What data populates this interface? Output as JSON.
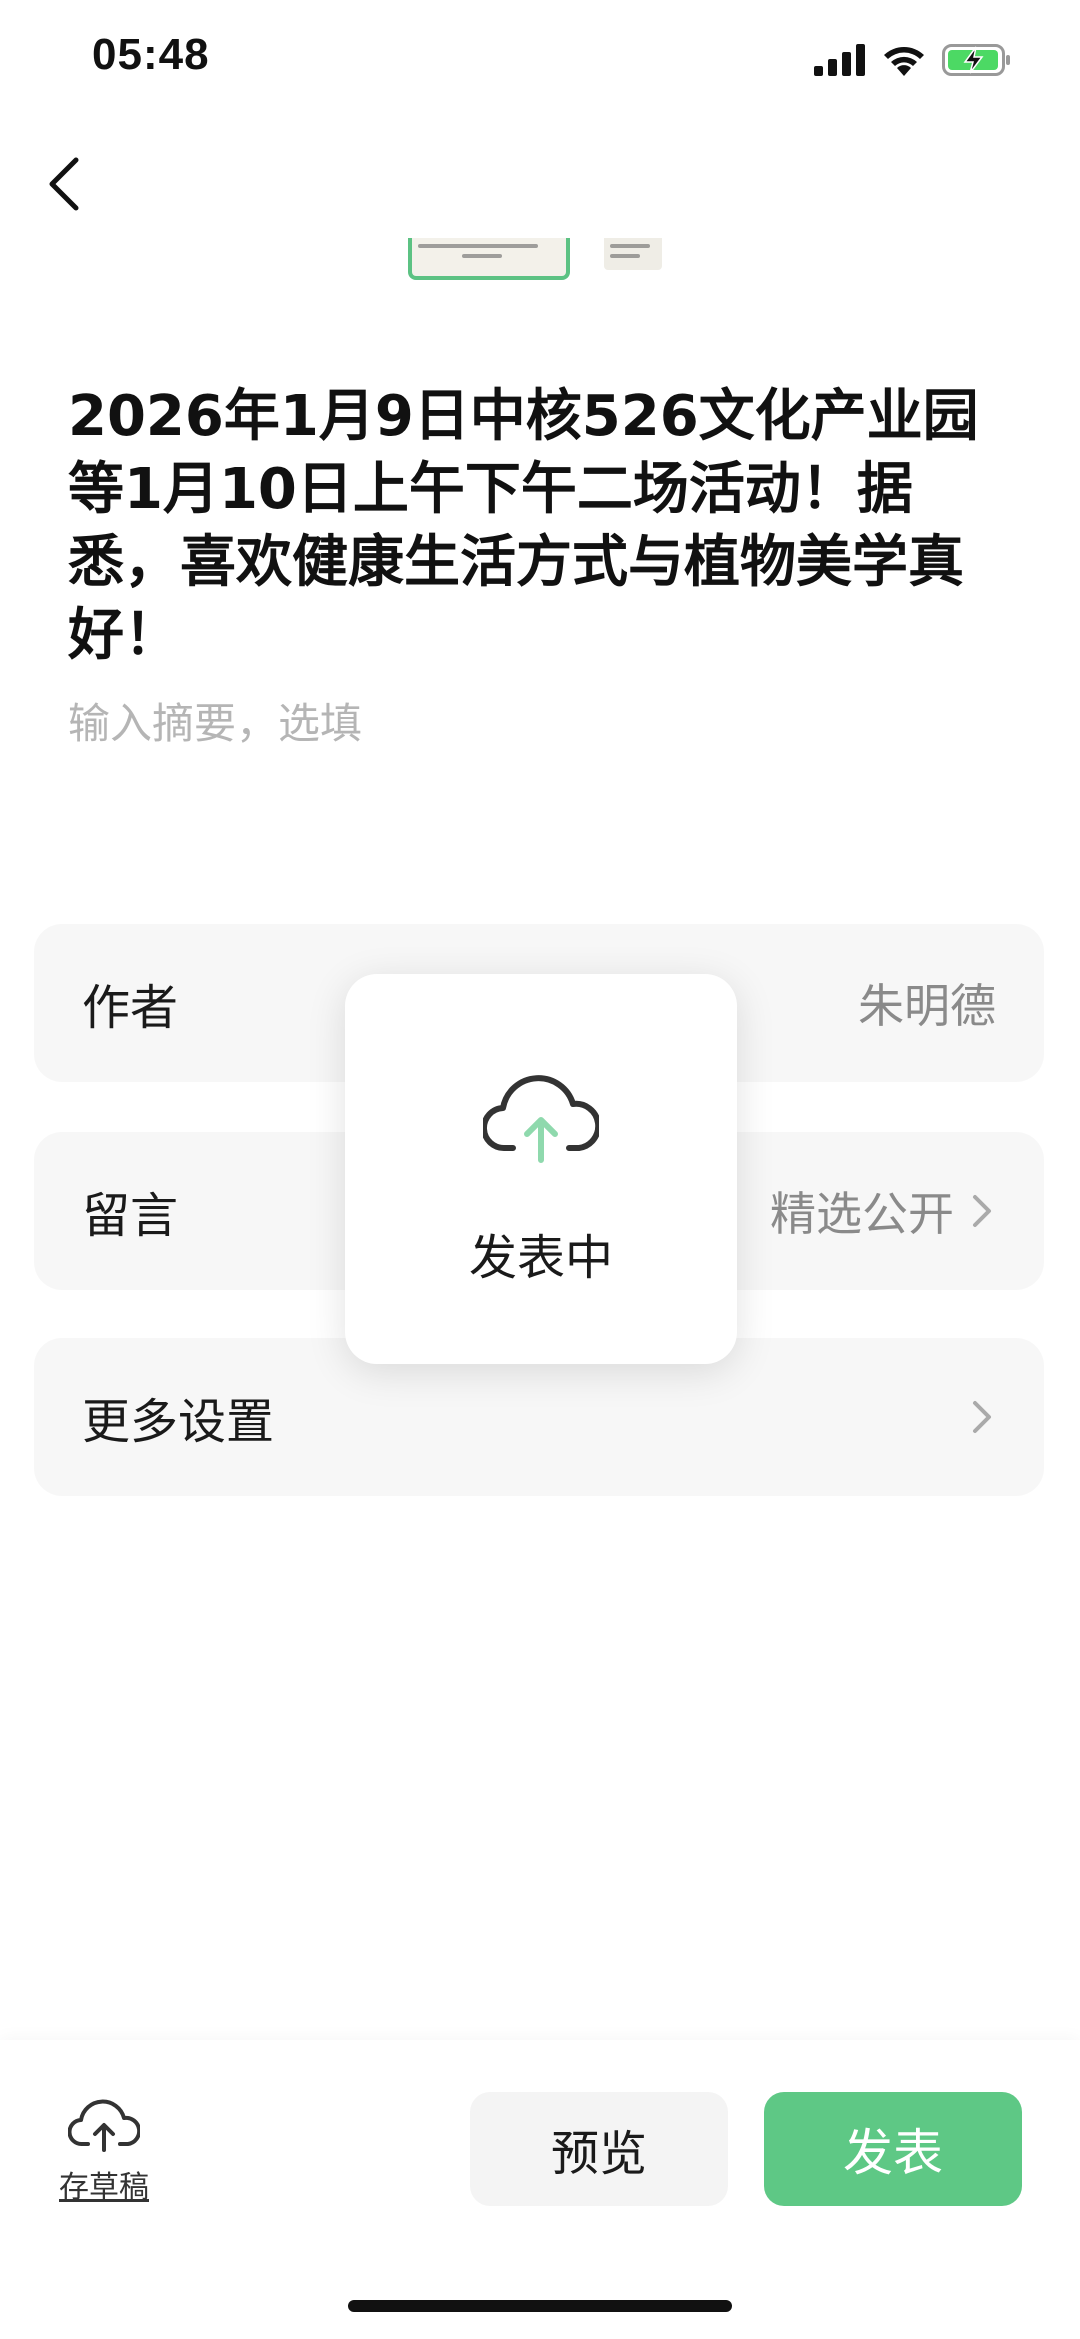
{
  "status_bar": {
    "time": "05:48",
    "icons": [
      "signal-icon",
      "wifi-icon",
      "battery-charging-icon"
    ]
  },
  "navigation": {
    "back_icon": "chevron-left-icon"
  },
  "article": {
    "title": "2026年1月9日中核526文化产业园等1月10日上午下午二场活动！据悉，喜欢健康生活方式与植物美学真好！",
    "summary_placeholder": "输入摘要，选填"
  },
  "settings": {
    "author_label": "作者",
    "author_value": "朱明德",
    "comment_label": "留言",
    "comment_value": "精选公开",
    "more_label": "更多设置"
  },
  "overlay": {
    "text": "发表中",
    "icon": "cloud-upload-icon"
  },
  "toolbar": {
    "save_draft_label": "存草稿",
    "preview_label": "预览",
    "publish_label": "发表"
  },
  "colors": {
    "accent": "#5ec885",
    "row_bg": "#f7f7f7",
    "placeholder": "#b5b5b5"
  }
}
